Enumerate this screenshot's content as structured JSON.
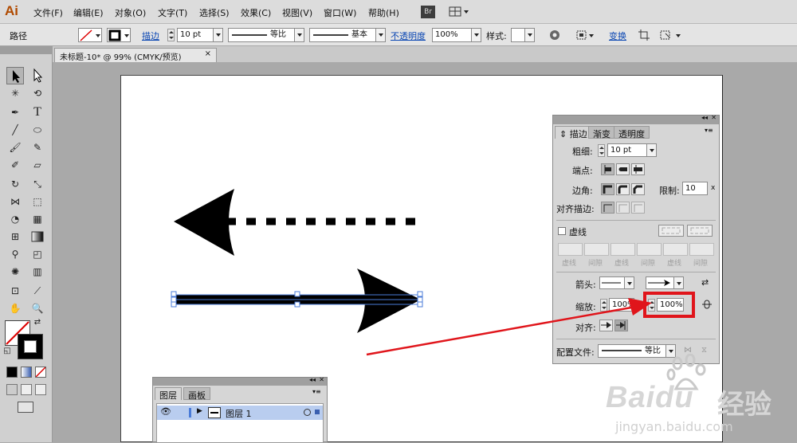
{
  "app": {
    "logo": "Ai"
  },
  "menubar": {
    "items": [
      "文件(F)",
      "编辑(E)",
      "对象(O)",
      "文字(T)",
      "选择(S)",
      "效果(C)",
      "视图(V)",
      "窗口(W)",
      "帮助(H)"
    ],
    "bridge_label": "Br"
  },
  "control": {
    "object_type": "路径",
    "stroke_link": "描边",
    "stroke_weight": "10 pt",
    "profile": "等比",
    "brush": "基本",
    "opacity_link": "不透明度",
    "opacity_value": "100%",
    "style_label": "样式:",
    "transform_link": "变换"
  },
  "document_tab": {
    "title": "未标题-10* @ 99% (CMYK/预览)",
    "close": "×"
  },
  "stroke_panel": {
    "tabs": [
      "描边",
      "渐变",
      "透明度"
    ],
    "weight_label": "粗细:",
    "weight_value": "10 pt",
    "cap_label": "端点:",
    "corner_label": "边角:",
    "limit_label": "限制:",
    "limit_value": "10",
    "limit_unit": "x",
    "align_stroke_label": "对齐描边:",
    "dashed_label": "虚线",
    "dash_labels": [
      "虚线",
      "间隙",
      "虚线",
      "间隙",
      "虚线",
      "间隙"
    ],
    "arrowheads_label": "箭头:",
    "scale_label": "缩放:",
    "scale_start": "100%",
    "scale_end": "100%",
    "align_label": "对齐:",
    "profile_label": "配置文件:",
    "profile_value": "等比"
  },
  "layers_panel": {
    "tabs": [
      "图层",
      "画板"
    ],
    "layer_name": "图层 1"
  },
  "watermark": {
    "brand": "Baidu",
    "text": "经验",
    "url": "jingyan.baidu.com"
  },
  "colors": {
    "highlight": "#e0151b",
    "accent_link": "#0b47b3"
  }
}
